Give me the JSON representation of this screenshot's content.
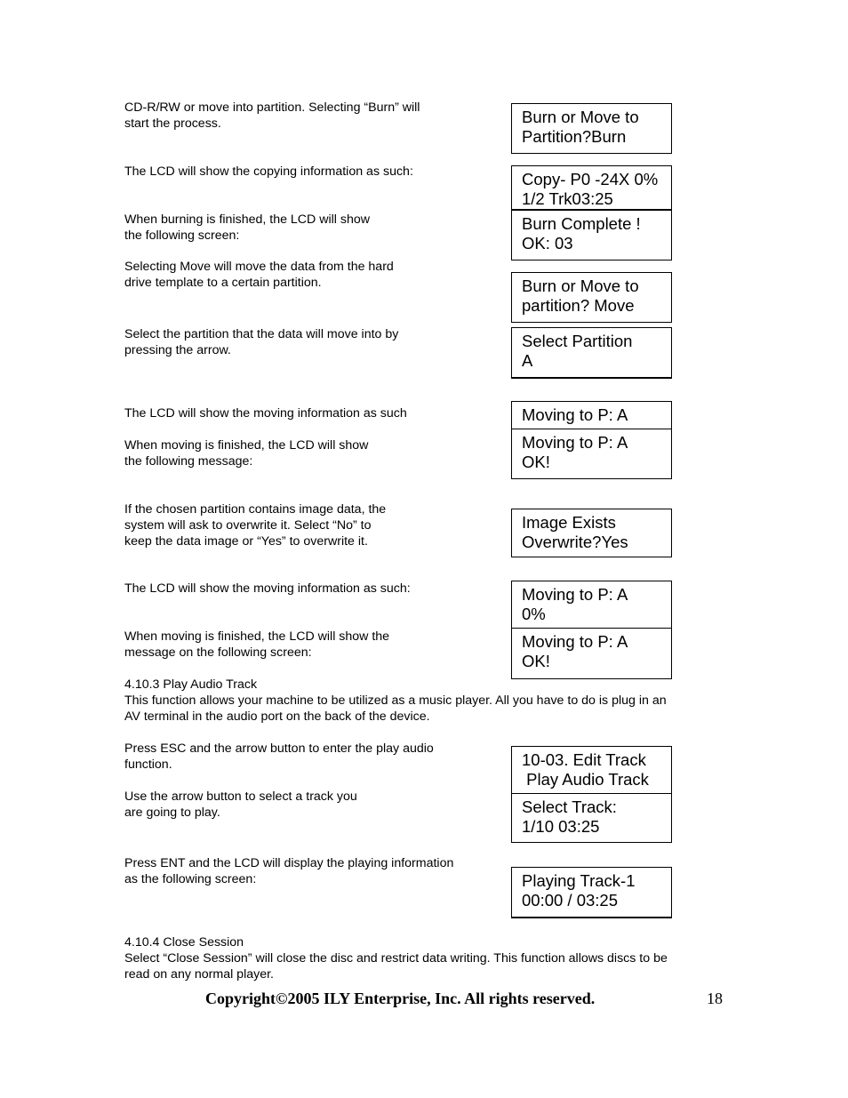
{
  "paragraphs": {
    "p1": "CD-R/RW or move into partition. Selecting “Burn” will\nstart the process.",
    "p2": "The LCD will show the copying information as such:",
    "p3": "When burning is finished, the LCD will show\nthe following screen:",
    "p4": "Selecting Move will move the data from the hard\ndrive template to a certain partition.",
    "p5": "Select the partition that the data will move into by\npressing the arrow.",
    "p6": "The LCD will show the moving information as such",
    "p7": "When moving is finished, the LCD will show\nthe following message:",
    "p8": "If the chosen partition contains image data, the\nsystem will ask to overwrite it. Select “No” to\nkeep the data image or “Yes” to overwrite it.",
    "p9": "The LCD will show the moving information as such:",
    "p10": "When moving is finished, the LCD will show the\nmessage on the following screen:",
    "h1": "4.10.3 Play Audio Track",
    "p11": "This function allows your machine to be utilized as a music player. All you have to do is plug in an\nAV terminal in the audio port on the back of the device.",
    "p12": "Press ESC and the arrow button to enter the play audio\nfunction.",
    "p13": "Use the arrow button to select a track you\nare going to play.",
    "p14": "Press ENT and the LCD will display the playing information\nas the following screen:",
    "h2": "4.10.4 Close Session",
    "p15": "Select “Close Session” will close the disc and restrict data writing. This function allows discs to be\nread on any normal player."
  },
  "lcd": [
    "Burn or Move to\nPartition?Burn",
    "Copy- P0 -24X 0%\n1/2 Trk03:25",
    "Burn Complete !\nOK: 03",
    "Burn or Move to\npartition? Move",
    "Select Partition\nA",
    "Moving to P: A",
    "Moving to P: A\nOK!",
    "Image Exists\nOverwrite?Yes",
    "Moving to P: A\n0%",
    "Moving to P: A\nOK!",
    "10-03. Edit Track\n Play Audio Track",
    "Select Track:\n1/10 03:25",
    "Playing Track-1\n00:00 / 03:25"
  ],
  "footer": {
    "copyright": "Copyright©2005 ILY Enterprise, Inc.  All rights reserved.",
    "page_number": "18"
  }
}
